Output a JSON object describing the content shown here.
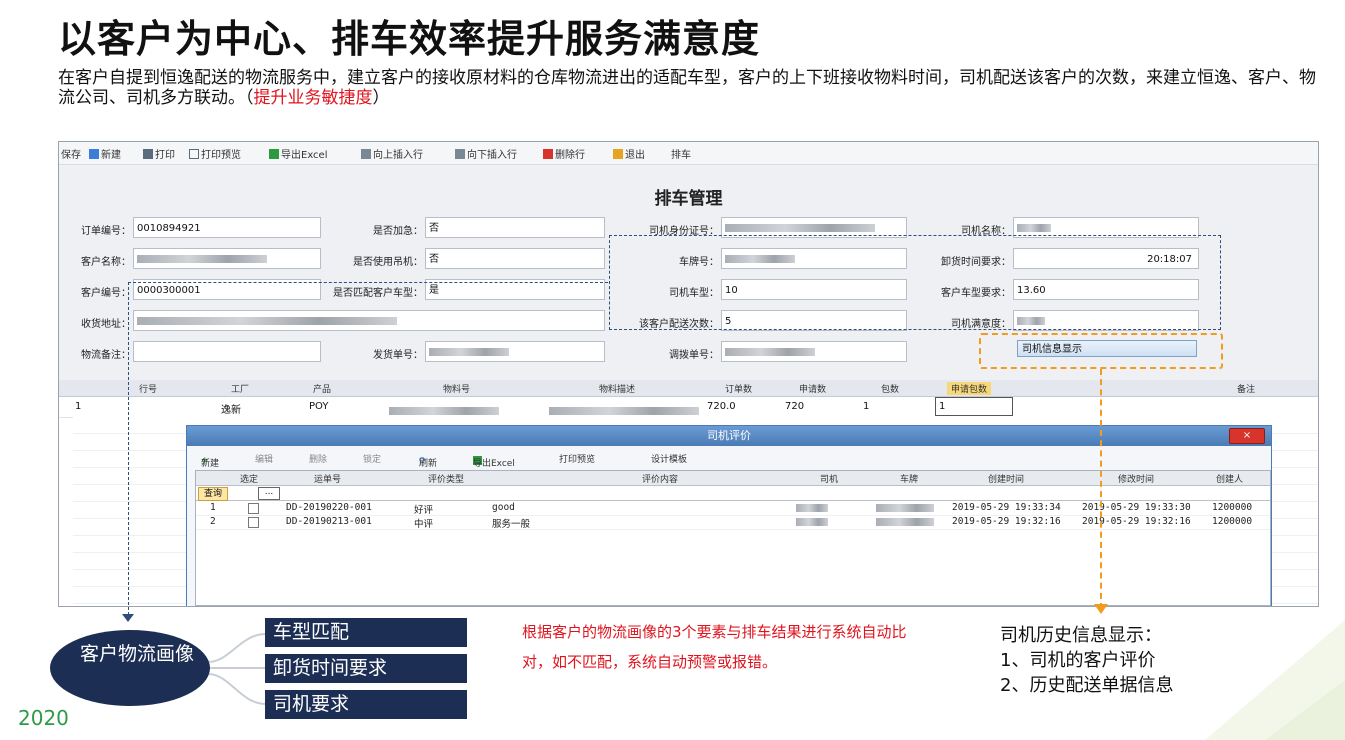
{
  "slide": {
    "title": "以客户为中心、排车效率提升服务满意度",
    "intro_text": "在客户自提到恒逸配送的物流服务中，建立客户的接收原材料的仓库物流进出的适配车型，客户的上下班接收物料时间，司机配送该客户的次数，来建立恒逸、客户、物流公司、司机多方联动。（",
    "intro_highlight": "提升业务敏捷度",
    "intro_tail": "）",
    "year": "2020"
  },
  "app": {
    "toolbar": {
      "items": [
        "保存",
        "新建",
        "打印",
        "打印预览",
        "导出Excel",
        "向上插入行",
        "向下插入行",
        "删除行",
        "退出",
        "排车"
      ]
    },
    "form_title": "排车管理",
    "fields": {
      "order_no_label": "订单编号：",
      "order_no": "0010894921",
      "need_pallet_label": "是否加急：",
      "need_pallet": "否",
      "driver_id_label": "司机身份证号：",
      "driver_name_label": "司机名称：",
      "customer_name_label": "客户名称：",
      "use_truck_label": "是否使用吊机：",
      "use_truck": "否",
      "plate_no_label": "车牌号：",
      "unload_time_label": "卸货时间要求：",
      "unload_time": "20:18:07",
      "customer_code_label": "客户编号：",
      "customer_code": "0000300001",
      "match_label": "是否匹配客户车型：",
      "match": "是",
      "driver_vehicle_label": "司机车型：",
      "driver_vehicle": "10",
      "customer_vehicle_label": "客户车型要求：",
      "customer_vehicle": "13.60",
      "address_label": "收货地址：",
      "deliver_count_label": "该客户配送次数：",
      "deliver_count": "5",
      "driver_req_label": "司机满意度：",
      "logistics_note_label": "物流备注：",
      "ship_no_label": "发货单号：",
      "adjust_no_label": "调拨单号："
    },
    "driver_info_button": "司机信息显示",
    "grid": {
      "columns": [
        "行号",
        "工厂",
        "产品",
        "物料号",
        "物料描述",
        "订单数",
        "申请数",
        "包数",
        "申请包数",
        "备注"
      ],
      "row": {
        "line": "1",
        "factory": "逸新",
        "product": "POY",
        "order_qty": "720.0",
        "apply_qty": "720",
        "packs": "1",
        "apply_packs": "1"
      }
    },
    "dialog": {
      "title": "司机评价",
      "close_label": "×",
      "toolbar": [
        "新建",
        "编辑",
        "删除",
        "锁定",
        "刷新",
        "导出Excel",
        "打印预览",
        "设计模板"
      ],
      "columns": [
        "选定",
        "运单号",
        "评价类型",
        "评价内容",
        "司机",
        "车牌",
        "创建时间",
        "修改时间",
        "创建人"
      ],
      "query_label": "查询",
      "filter_btn": "...",
      "rows": [
        {
          "no": "1",
          "waybill": "DD-20190220-001",
          "type": "好评",
          "content": "good",
          "created": "2019-05-29 19:33:34",
          "modified": "2019-05-29 19:33:30",
          "creator": "1200000"
        },
        {
          "no": "2",
          "waybill": "DD-20190213-001",
          "type": "中评",
          "content": "服务一般",
          "created": "2019-05-29 19:32:16",
          "modified": "2019-05-29 19:32:16",
          "creator": "1200000"
        }
      ]
    }
  },
  "diagram": {
    "portrait_label": "客户物流画像",
    "tags": [
      "车型匹配",
      "卸货时间要求",
      "司机要求"
    ],
    "red_note": "根据客户的物流画像的3个要素与排车结果进行系统自动比对，如不匹配，系统自动预警或报错。",
    "history_title": "司机历史信息显示：",
    "history_items": [
      "1、司机的客户评价",
      "2、历史配送单据信息"
    ]
  },
  "colors": {
    "navy": "#1c2e53",
    "red": "#e0141e",
    "orange": "#f29b1c",
    "green": "#2f9a46"
  }
}
